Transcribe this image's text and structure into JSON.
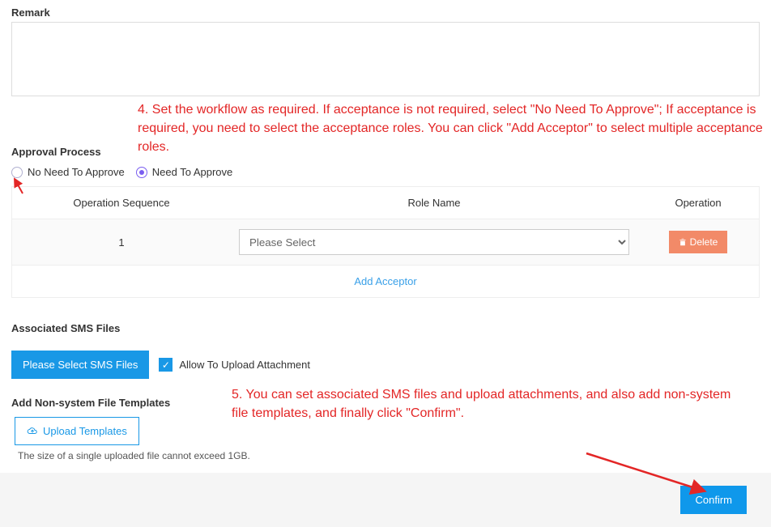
{
  "remark": {
    "label": "Remark",
    "value": ""
  },
  "annotation4": "4. Set the workflow as required. If acceptance is not required, select \"No Need To Approve\"; If acceptance is required, you need to select the acceptance roles. You can click \"Add Acceptor\" to select multiple acceptance roles.",
  "approval": {
    "label": "Approval Process",
    "option_no_need": "No Need To Approve",
    "option_need": "Need To Approve",
    "selected": "need"
  },
  "table": {
    "headers": {
      "seq": "Operation Sequence",
      "role": "Role Name",
      "op": "Operation"
    },
    "rows": [
      {
        "seq": "1",
        "role_placeholder": "Please Select",
        "delete_label": "Delete"
      }
    ],
    "add_acceptor": "Add Acceptor"
  },
  "sms": {
    "label": "Associated SMS Files",
    "select_btn": "Please Select SMS Files",
    "allow_upload": "Allow To Upload Attachment",
    "allow_upload_checked": true
  },
  "annotation5": "5. You can set associated SMS files and upload attachments, and also add non-system file templates, and finally click \"Confirm\".",
  "nonsystem": {
    "label": "Add Non-system File Templates",
    "upload_btn": "Upload Templates",
    "hint": "The size of a single uploaded file cannot exceed 1GB."
  },
  "footer": {
    "confirm": "Confirm"
  }
}
